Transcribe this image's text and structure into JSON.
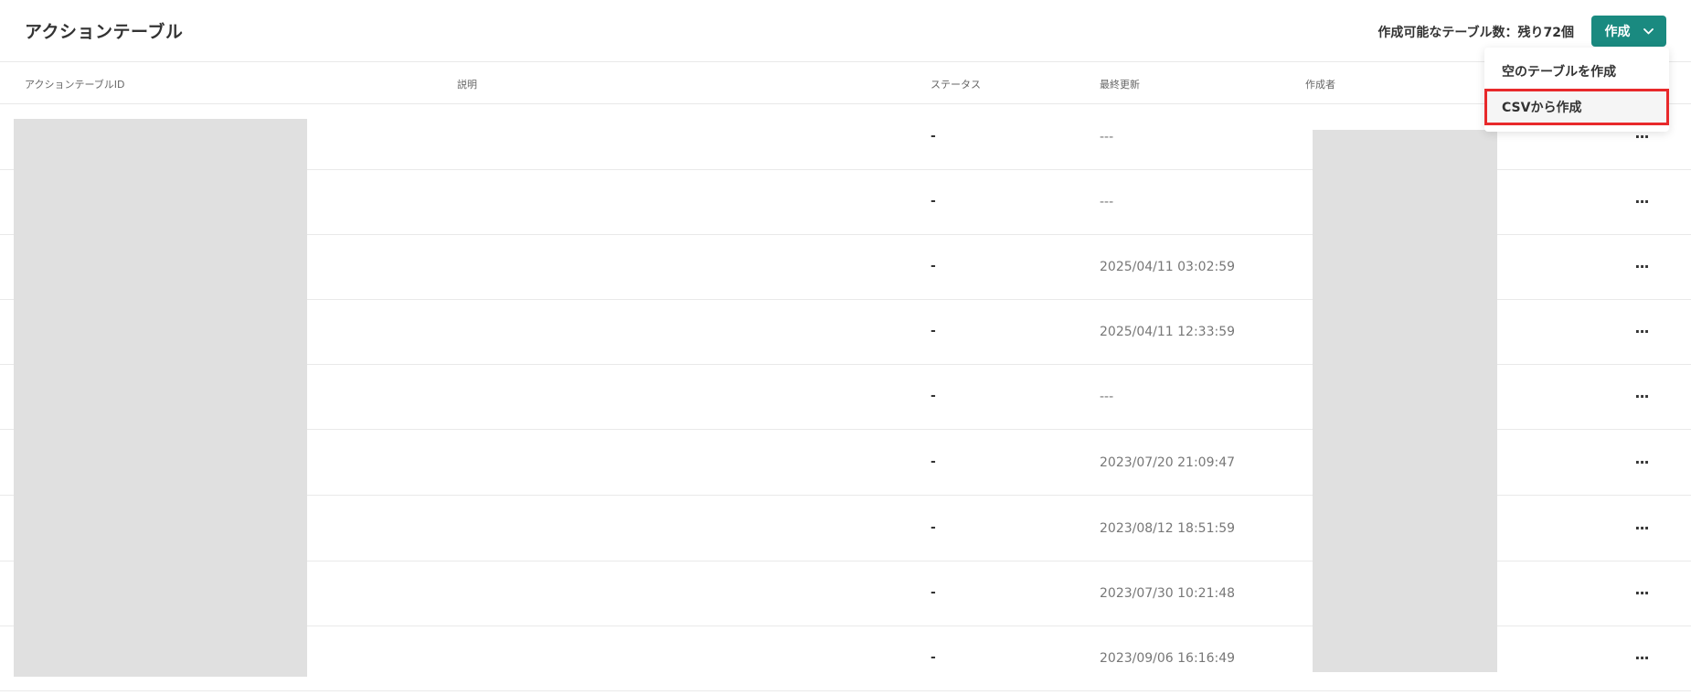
{
  "header": {
    "title": "アクションテーブル",
    "quota": "作成可能なテーブル数：残り72個",
    "create_label": "作成",
    "create_chevron": "⌄"
  },
  "columns": {
    "id": "アクションテーブルID",
    "description": "説明",
    "status": "ステータス",
    "updated": "最終更新",
    "author": "作成者"
  },
  "dropdown": {
    "items": [
      {
        "label": "空のテーブルを作成"
      },
      {
        "label": "CSVから作成"
      }
    ]
  },
  "rows": [
    {
      "status": "-",
      "updated": "---"
    },
    {
      "status": "-",
      "updated": "---"
    },
    {
      "status": "-",
      "updated": "2025/04/11 03:02:59"
    },
    {
      "status": "-",
      "updated": "2025/04/11 12:33:59"
    },
    {
      "status": "-",
      "updated": "---"
    },
    {
      "status": "-",
      "updated": "2023/07/20 21:09:47"
    },
    {
      "status": "-",
      "updated": "2023/08/12 18:51:59"
    },
    {
      "status": "-",
      "updated": "2023/07/30 10:21:48"
    },
    {
      "status": "-",
      "updated": "2023/09/06 16:16:49"
    }
  ],
  "more_icon": "···"
}
